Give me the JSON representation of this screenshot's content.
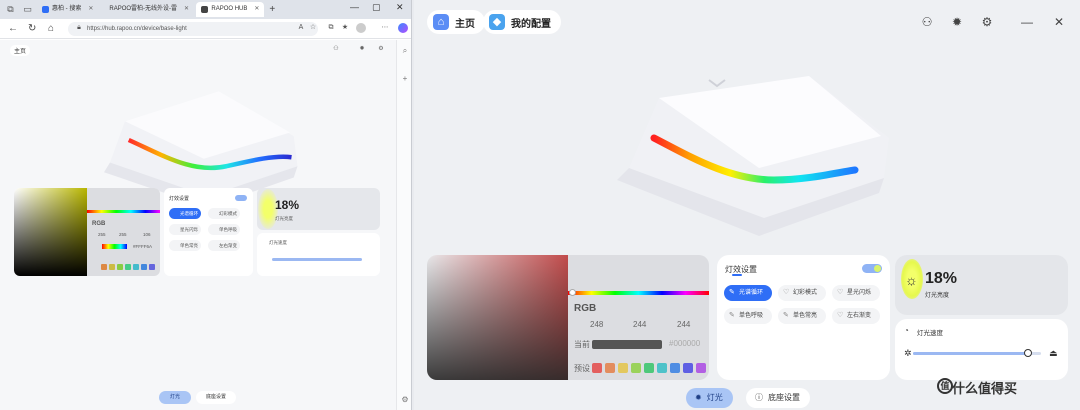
{
  "browser": {
    "tabs": [
      {
        "label": "惠柏 - 搜索",
        "active": false,
        "color": "#2f6ef6"
      },
      {
        "label": "RAPOO雷柏-无线外设-雷",
        "active": false,
        "color": "#d33"
      },
      {
        "label": "RAPOO HUB",
        "active": true,
        "color": "#444"
      }
    ],
    "new_tab": "+",
    "url": "https://hub.rapoo.cn/device/base-light",
    "controls": {
      "min": "—",
      "max": "▢",
      "close": "✕"
    },
    "mini_app": {
      "home": "主页",
      "rgb": "RGB",
      "r": "255",
      "g": "255",
      "b": "106",
      "hex": "#FFFF6A",
      "fx_title": "灯效设置",
      "fx_items": [
        "光谱循环",
        "幻彩模式",
        "星光闪烁",
        "单色呼吸",
        "单色常亮",
        "左右渐变"
      ],
      "brightness": "18%",
      "brightness_label": "灯光亮度",
      "speed_label": "灯光速度",
      "tab_light": "灯光",
      "tab_base": "底座设置"
    }
  },
  "app": {
    "header": {
      "home": "主页",
      "my_config": "我的配置"
    },
    "color": {
      "rgb_label": "RGB",
      "r": "248",
      "g": "244",
      "b": "244",
      "current_label": "当前",
      "hex": "#000000",
      "preset_label": "预设",
      "presets": [
        "#e35f5f",
        "#e38d5f",
        "#e3c85f",
        "#9bd25b",
        "#4ec87a",
        "#4ec2c9",
        "#4f8de3",
        "#5f5fe3",
        "#b25fe3"
      ]
    },
    "effects": {
      "title": "灯效设置",
      "enabled": true,
      "items": [
        {
          "label": "光谱循环",
          "icon": "spectrum-icon",
          "glyph": "✎",
          "active": true
        },
        {
          "label": "幻彩模式",
          "icon": "shield-icon",
          "glyph": "♡",
          "active": false
        },
        {
          "label": "星光闪烁",
          "icon": "star-icon",
          "glyph": "♡",
          "active": false
        },
        {
          "label": "单色呼吸",
          "icon": "breath-icon",
          "glyph": "✎",
          "active": false
        },
        {
          "label": "单色常亮",
          "icon": "steady-icon",
          "glyph": "✎",
          "active": false
        },
        {
          "label": "左右渐变",
          "icon": "gradient-icon",
          "glyph": "♡",
          "active": false
        }
      ]
    },
    "brightness": {
      "value": "18%",
      "label": "灯光亮度",
      "level": 0.18
    },
    "speed": {
      "label": "灯光速度",
      "level": 0.9
    },
    "bottom_tabs": {
      "light": "灯光",
      "base": "底座设置"
    },
    "watermark": "什么值得买",
    "watermark_logo": "值"
  }
}
